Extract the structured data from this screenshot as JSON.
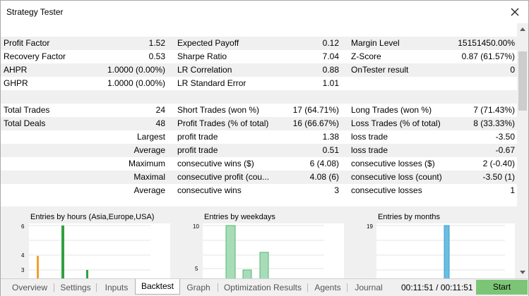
{
  "window": {
    "title": "Strategy Tester"
  },
  "stats": {
    "row1": [
      "Profit Factor",
      "1.52",
      "Expected Payoff",
      "0.12",
      "Margin Level",
      "15151450.00%"
    ],
    "row2": [
      "Recovery Factor",
      "0.53",
      "Sharpe Ratio",
      "7.04",
      "Z-Score",
      "0.87 (61.57%)"
    ],
    "row3": [
      "AHPR",
      "1.0000 (0.00%)",
      "LR Correlation",
      "0.88",
      "OnTester result",
      "0"
    ],
    "row4": [
      "GHPR",
      "1.0000 (0.00%)",
      "LR Standard Error",
      "1.01",
      "",
      ""
    ],
    "row5": [
      "Total Trades",
      "24",
      "Short Trades (won %)",
      "17 (64.71%)",
      "Long Trades (won %)",
      "7 (71.43%)"
    ],
    "row6": [
      "Total Deals",
      "48",
      "Profit Trades (% of total)",
      "16 (66.67%)",
      "Loss Trades (% of total)",
      "8 (33.33%)"
    ],
    "row7": [
      "Largest",
      "profit trade",
      "1.38",
      "loss trade",
      "-3.50"
    ],
    "row8": [
      "Average",
      "profit trade",
      "0.51",
      "loss trade",
      "-0.67"
    ],
    "row9": [
      "Maximum",
      "consecutive wins ($)",
      "6 (4.08)",
      "consecutive losses ($)",
      "2 (-0.40)"
    ],
    "row10": [
      "Maximal",
      "consecutive profit (cou...",
      "4.08 (6)",
      "consecutive loss (count)",
      "-3.50 (1)"
    ],
    "row11": [
      "Average",
      "consecutive wins",
      "3",
      "consecutive losses",
      "1"
    ]
  },
  "charts": [
    {
      "title": "Entries by hours (Asia,Europe,USA)",
      "y_ticks": [
        "6",
        "4",
        "3"
      ],
      "colors": [
        "#f0a030",
        "#30a040"
      ]
    },
    {
      "title": "Entries by weekdays",
      "y_ticks": [
        "10",
        "5"
      ],
      "colors": [
        "#50b870"
      ]
    },
    {
      "title": "Entries by months",
      "y_ticks": [
        "19"
      ],
      "colors": [
        "#3aa0d0"
      ]
    }
  ],
  "tabs": [
    "Overview",
    "Settings",
    "Inputs",
    "Backtest",
    "Graph",
    "Optimization Results",
    "Agents",
    "Journal"
  ],
  "active_tab": "Backtest",
  "time": "00:11:51 / 00:11:51",
  "start_label": "Start"
}
